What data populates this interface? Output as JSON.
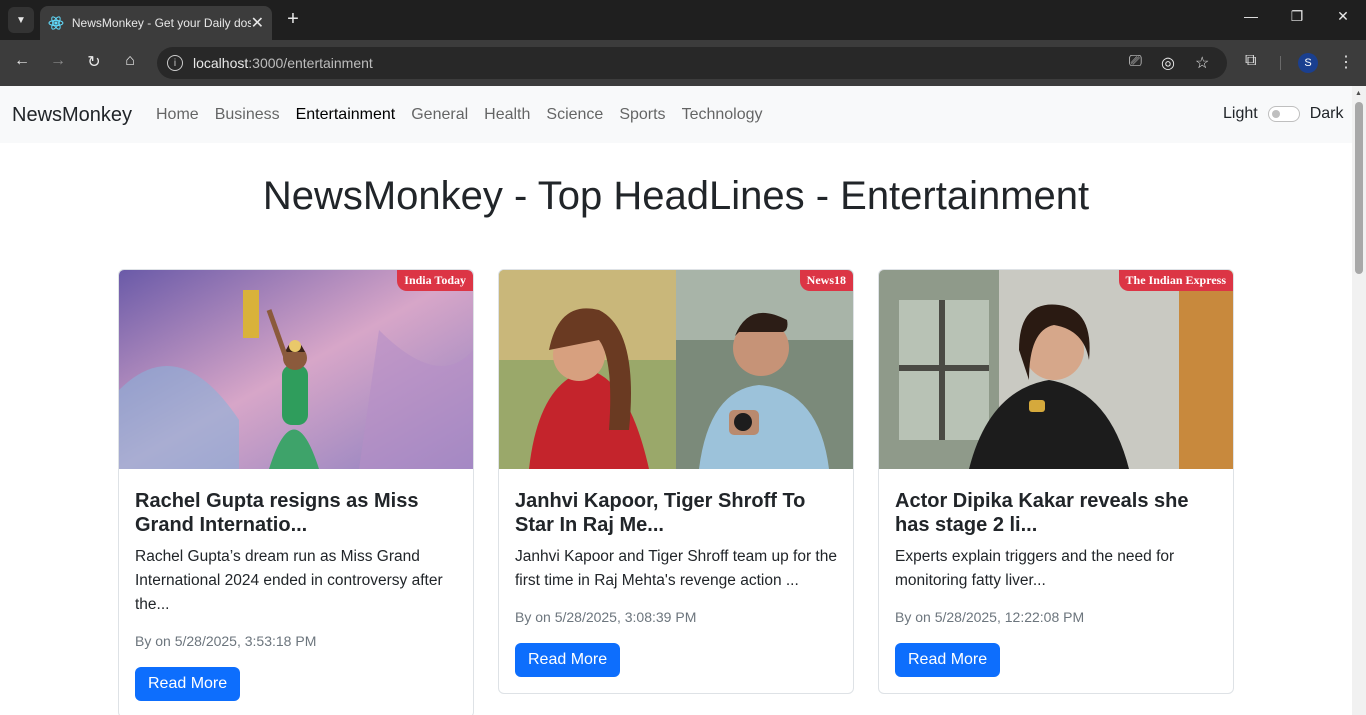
{
  "browser": {
    "tab_title": "NewsMonkey - Get your Daily dose of news",
    "url_host": "localhost",
    "url_path": ":3000/entertainment",
    "profile_initial": "S"
  },
  "navbar": {
    "brand": "NewsMonkey",
    "links": [
      "Home",
      "Business",
      "Entertainment",
      "General",
      "Health",
      "Science",
      "Sports",
      "Technology"
    ],
    "active": "Entertainment",
    "mode_light": "Light",
    "mode_dark": "Dark"
  },
  "page": {
    "heading": "NewsMonkey - Top HeadLines - Entertainment"
  },
  "cards": [
    {
      "source": "India Today",
      "title": "Rachel Gupta resigns as Miss Grand Internatio...",
      "description": "Rachel Gupta’s dream run as Miss Grand International 2024 ended in controversy after the...",
      "meta": "By on 5/28/2025, 3:53:18 PM",
      "button": "Read More"
    },
    {
      "source": "News18",
      "title": "Janhvi Kapoor, Tiger Shroff To Star In Raj Me...",
      "description": "Janhvi Kapoor and Tiger Shroff team up for the first time in Raj Mehta's revenge action ...",
      "meta": "By on 5/28/2025, 3:08:39 PM",
      "button": "Read More"
    },
    {
      "source": "The Indian Express",
      "title": "Actor Dipika Kakar reveals she has stage 2 li...",
      "description": "Experts explain triggers and the need for monitoring fatty liver...",
      "meta": "By on 5/28/2025, 12:22:08 PM",
      "button": "Read More"
    }
  ],
  "colors": {
    "primary": "#0d6efd",
    "badge": "#dc3545",
    "navbar_bg": "#f8f9fa"
  }
}
